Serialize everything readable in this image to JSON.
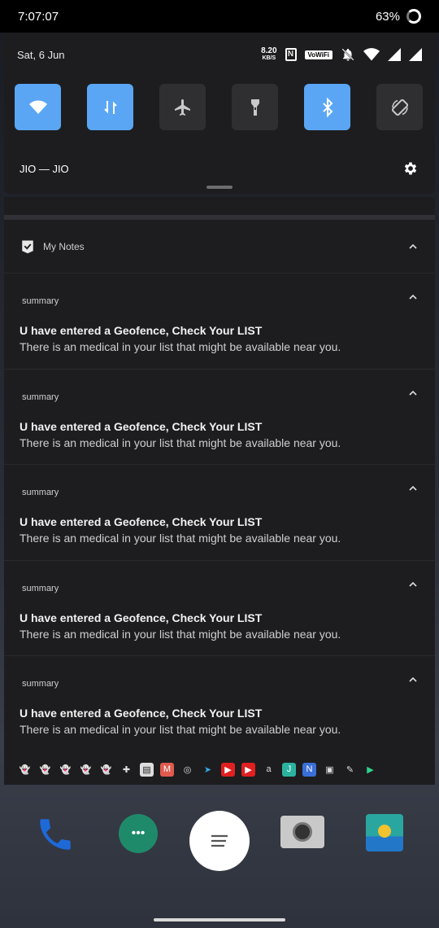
{
  "status_bar": {
    "time": "7:07:07",
    "battery": "63%"
  },
  "quick_settings": {
    "date": "Sat, 6 Jun",
    "net_speed_value": "8.20",
    "net_speed_unit": "KB/S",
    "volte_label": "VoWiFi",
    "nfc_label": "N",
    "operator": "JIO — JIO",
    "tiles": [
      {
        "name": "wifi",
        "active": true
      },
      {
        "name": "mobile-data",
        "active": true
      },
      {
        "name": "airplane",
        "active": false
      },
      {
        "name": "flashlight",
        "active": false
      },
      {
        "name": "bluetooth",
        "active": true
      },
      {
        "name": "auto-rotate",
        "active": false
      }
    ]
  },
  "notifications": {
    "group_app": "My Notes",
    "items": [
      {
        "subtext": "summary",
        "title": "U have entered a Geofence, Check Your LIST",
        "body": "There is an medical in your list that might be available near you."
      },
      {
        "subtext": "summary",
        "title": "U have entered a Geofence, Check Your LIST",
        "body": "There is an medical in your list that might be available near you."
      },
      {
        "subtext": "summary",
        "title": "U have entered a Geofence, Check Your LIST",
        "body": "There is an medical in your list that might be available near you."
      },
      {
        "subtext": "summary",
        "title": "U have entered a Geofence, Check Your LIST",
        "body": "There is an medical in your list that might be available near you."
      },
      {
        "subtext": "summary",
        "title": "U have entered a Geofence, Check Your LIST",
        "body": "There is an medical in your list that might be available near you."
      }
    ]
  },
  "colors": {
    "accent": "#5aa6f5",
    "panel": "#1d1d1f",
    "tile_off": "#2f2f32"
  }
}
